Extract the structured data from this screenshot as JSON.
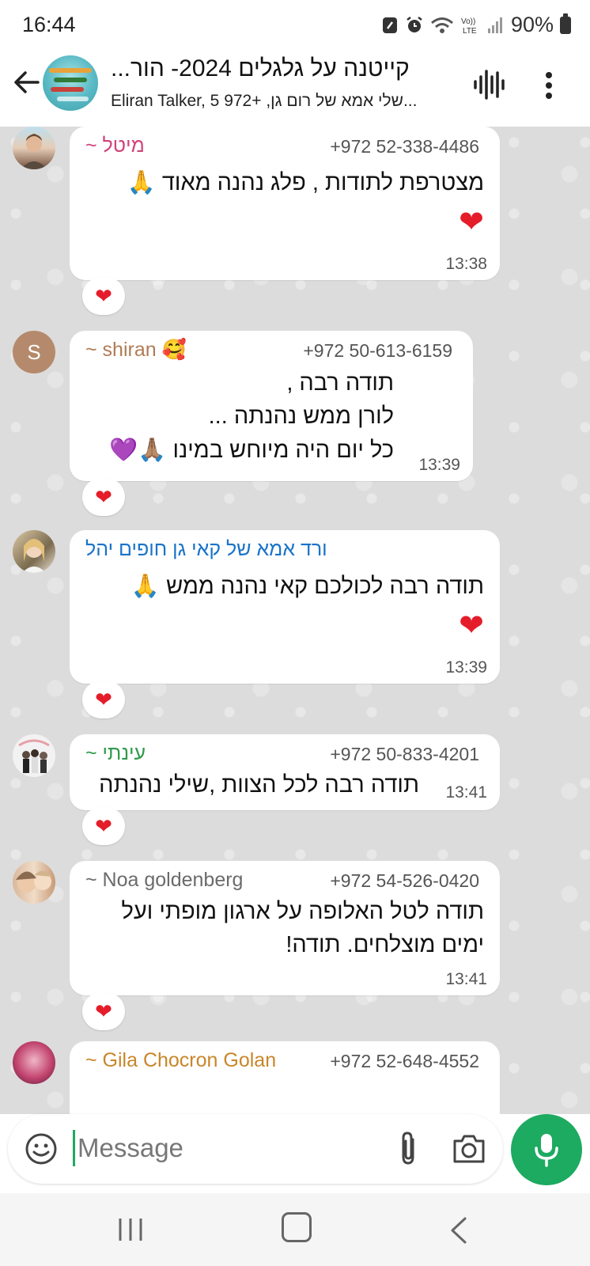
{
  "status_bar": {
    "time": "16:44",
    "battery": "90%"
  },
  "header": {
    "title": "קייטנה על גלגלים 2024- הור...",
    "subtitle": "Eliran Talker, שלי אמא של רום גן, +972 5..."
  },
  "messages": [
    {
      "sender": "~ מיטל",
      "phone": "+972 52-338-4486",
      "lines": [
        "מצטרפת לתודות , פלג נהנה מאוד 🙏"
      ],
      "big_emoji": "❤",
      "time": "13:38",
      "reaction": "❤"
    },
    {
      "sender": "~ shiran 🥰",
      "avatar_letter": "S",
      "phone": "+972 50-613-6159",
      "lines": [
        "תודה רבה ,",
        "לורן ממש נהנתה ...",
        "כל יום היה מיוחש במינו 🙏🏽💜"
      ],
      "time": "13:39",
      "reaction": "❤"
    },
    {
      "sender": "ורד אמא של קאי גן חופים יהל",
      "lines": [
        "תודה רבה לכולכם קאי נהנה ממש 🙏"
      ],
      "big_emoji": "❤",
      "time": "13:39",
      "reaction": "❤"
    },
    {
      "sender": "~ עינתי",
      "phone": "+972 50-833-4201",
      "lines": [
        "תודה רבה לכל הצוות ,שילי נהנתה"
      ],
      "time": "13:41",
      "reaction": "❤"
    },
    {
      "sender": "~ Noa goldenberg",
      "phone": "+972 54-526-0420",
      "lines": [
        "תודה לטל האלופה על ארגון מופתי ועל",
        "ימים מוצלחים. תודה!"
      ],
      "time": "13:41",
      "reaction": "❤"
    },
    {
      "sender": "~ Gila Chocron Golan",
      "phone": "+972 52-648-4552"
    }
  ],
  "input": {
    "placeholder": "Message"
  },
  "colors": {
    "accent_green": "#1daa61",
    "sender_1": "#d1437a",
    "sender_2": "#b07c56",
    "sender_3": "#1a73c9",
    "sender_4": "#2f9a4a",
    "sender_5": "#6b6b6b",
    "sender_6": "#c9862a"
  }
}
